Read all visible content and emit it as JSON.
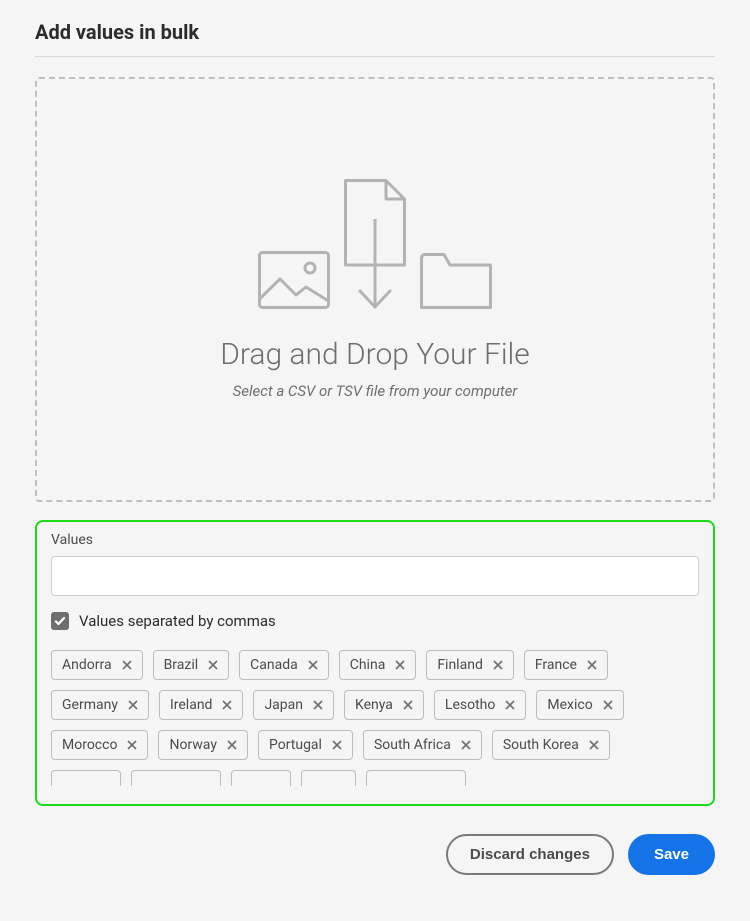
{
  "title": "Add values in bulk",
  "dropzone": {
    "heading": "Drag and Drop Your File",
    "subtext": "Select a CSV or TSV file from your computer"
  },
  "values": {
    "label": "Values",
    "input_value": "",
    "checkbox_label": "Values separated by commas",
    "checkbox_checked": true,
    "tags": [
      "Andorra",
      "Brazil",
      "Canada",
      "China",
      "Finland",
      "France",
      "Germany",
      "Ireland",
      "Japan",
      "Kenya",
      "Lesotho",
      "Mexico",
      "Morocco",
      "Norway",
      "Portugal",
      "South Africa",
      "South Korea"
    ],
    "partial_tag_widths": [
      70,
      90,
      60,
      55,
      100
    ]
  },
  "footer": {
    "discard": "Discard changes",
    "save": "Save"
  }
}
